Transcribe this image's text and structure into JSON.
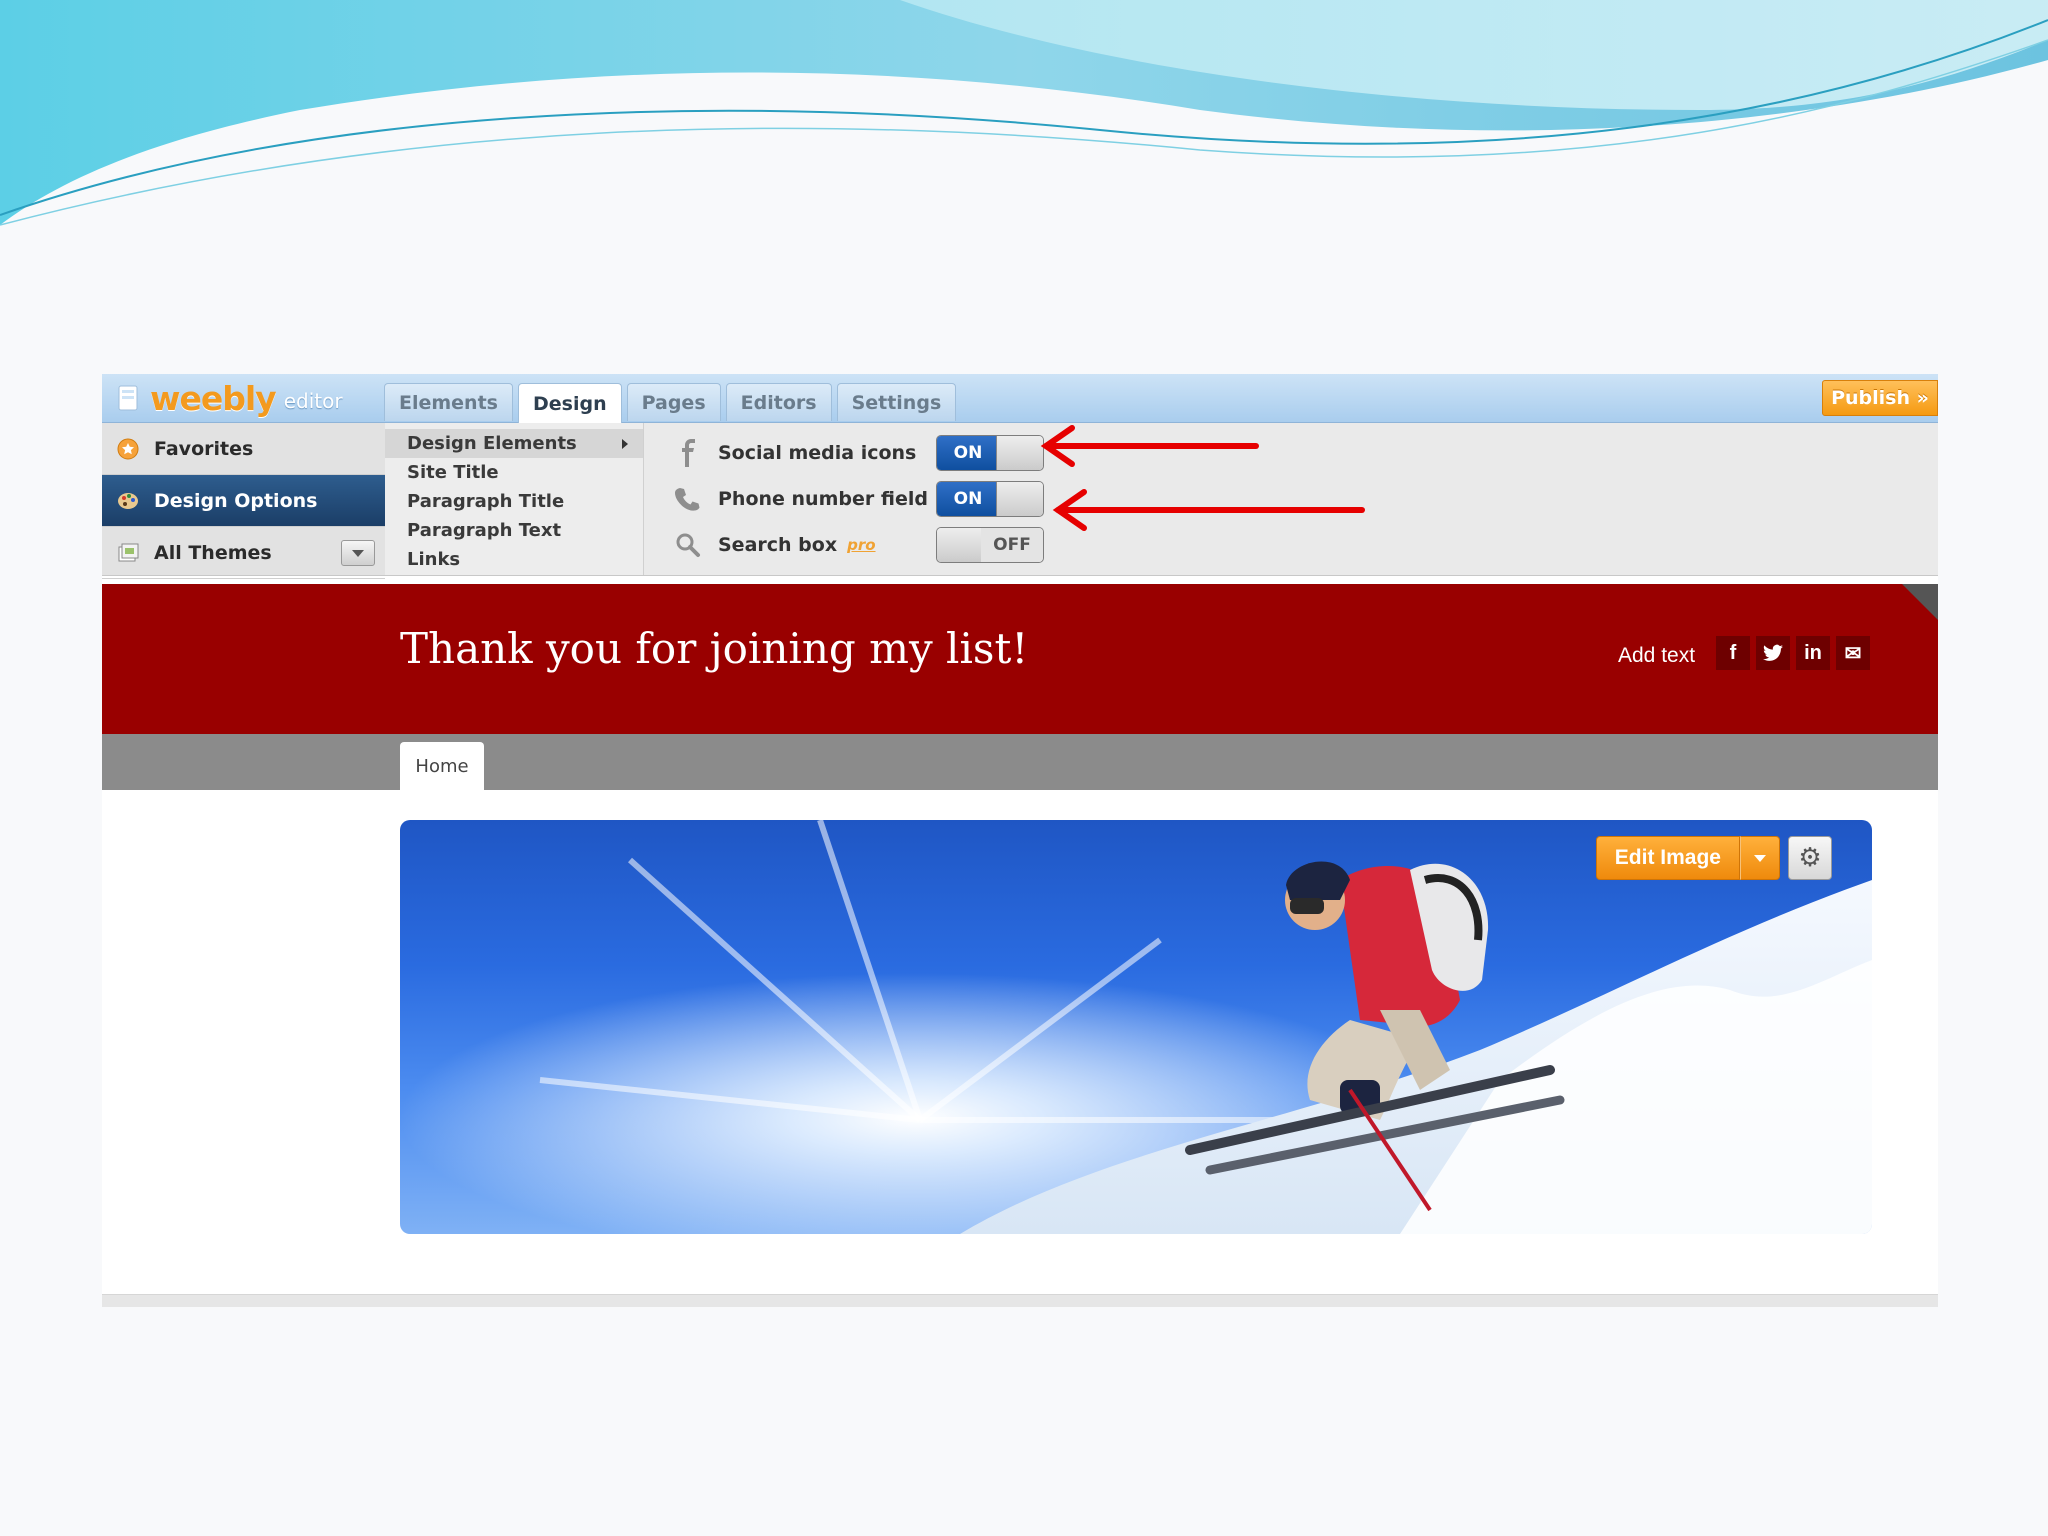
{
  "colors": {
    "brand_orange": "#f39a1e",
    "header_red": "#990000",
    "toggle_on_blue": "#1a5db4",
    "arrow_red": "#e60000",
    "nav_gray": "#8b8b8b"
  },
  "topbar": {
    "logo_text": "weebly",
    "logo_suffix": "editor",
    "tabs": [
      {
        "label": "Elements",
        "active": false
      },
      {
        "label": "Design",
        "active": true
      },
      {
        "label": "Pages",
        "active": false
      },
      {
        "label": "Editors",
        "active": false
      },
      {
        "label": "Settings",
        "active": false
      }
    ],
    "publish_label": "Publish »"
  },
  "sidebar": {
    "items": [
      {
        "label": "Favorites",
        "icon": "star-icon"
      },
      {
        "label": "Design Options",
        "icon": "palette-icon",
        "active": true
      },
      {
        "label": "All Themes",
        "icon": "themes-icon"
      }
    ]
  },
  "submenu": {
    "items": [
      {
        "label": "Design Elements",
        "active": true
      },
      {
        "label": "Site Title"
      },
      {
        "label": "Paragraph Title"
      },
      {
        "label": "Paragraph Text"
      },
      {
        "label": "Links"
      }
    ]
  },
  "options": {
    "items": [
      {
        "label": "Social media icons",
        "icon": "facebook-icon",
        "state": "ON"
      },
      {
        "label": "Phone number field",
        "icon": "phone-icon",
        "state": "ON"
      },
      {
        "label": "Search box",
        "icon": "search-icon",
        "state": "OFF",
        "badge": "pro"
      }
    ]
  },
  "site": {
    "title": "Thank you for joining my list!",
    "add_text": "Add text",
    "social": [
      "f",
      "t",
      "in",
      "✉"
    ],
    "nav": {
      "home": "Home"
    }
  },
  "hero": {
    "edit_image_label": "Edit Image"
  }
}
